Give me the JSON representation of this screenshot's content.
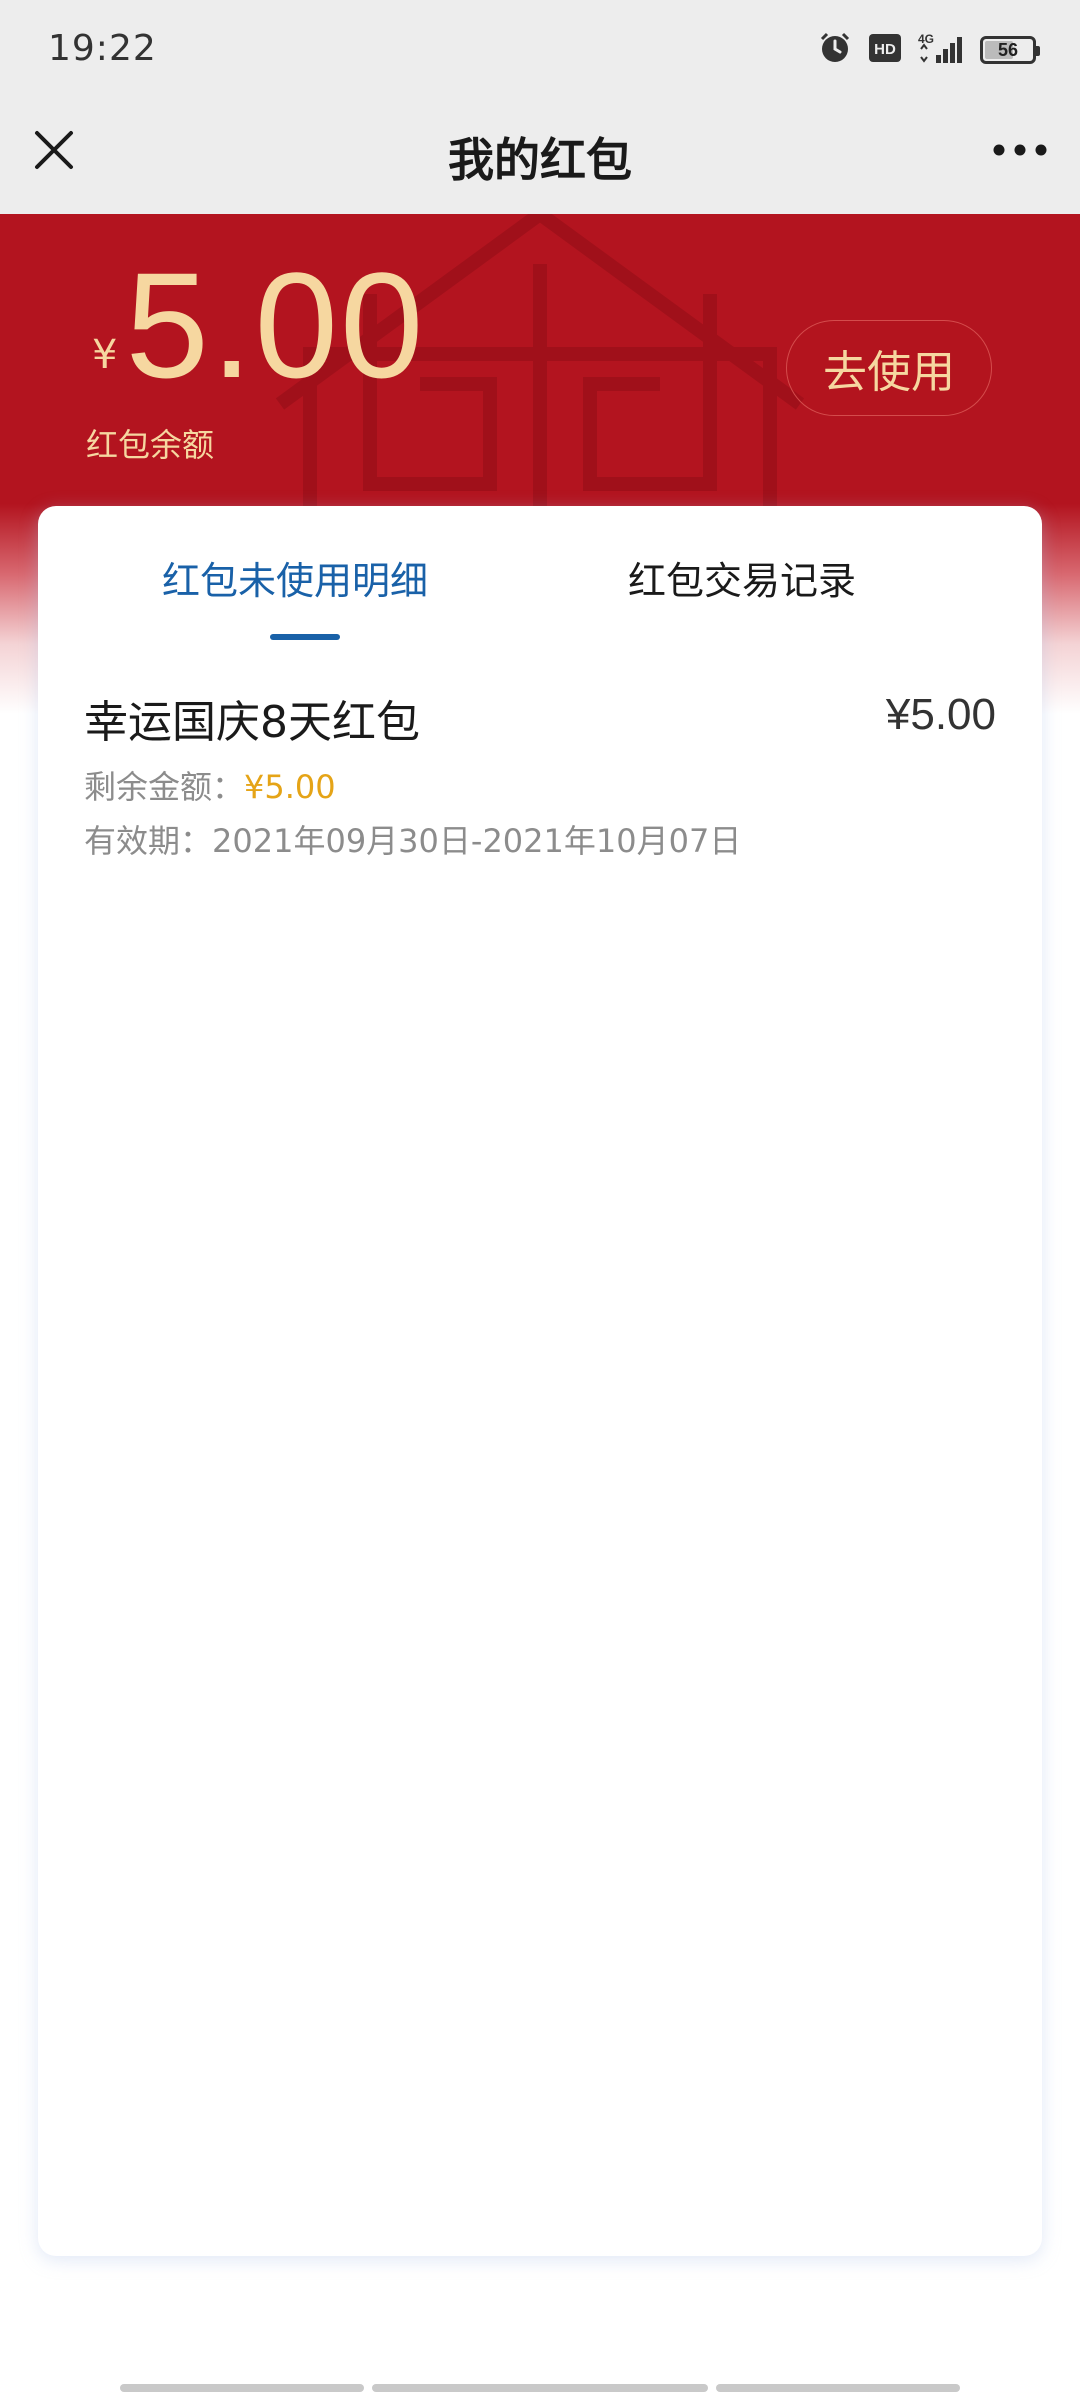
{
  "status_bar": {
    "time": "19:22",
    "icons": [
      "alarm-icon",
      "hd-icon",
      "4g-signal-icon"
    ],
    "battery": "56"
  },
  "nav": {
    "title": "我的红包",
    "close_icon": "close-icon",
    "more_icon": "more-icon"
  },
  "balance": {
    "currency": "¥",
    "amount": "5.00",
    "label": "红包余额",
    "use_button": "去使用"
  },
  "tabs": [
    {
      "label": "红包未使用明细",
      "active": true
    },
    {
      "label": "红包交易记录",
      "active": false
    }
  ],
  "items": [
    {
      "title": "幸运国庆8天红包",
      "amount": "¥5.00",
      "remaining_label": "剩余金额：",
      "remaining_value": "¥5.00",
      "validity_label": "有效期：",
      "validity_value": "2021年09月30日-2021年10月07日"
    }
  ],
  "colors": {
    "header_red": "#b3141f",
    "gold": "#f6d7a0",
    "tab_blue": "#1961a8",
    "remaining_orange": "#e5a417"
  }
}
